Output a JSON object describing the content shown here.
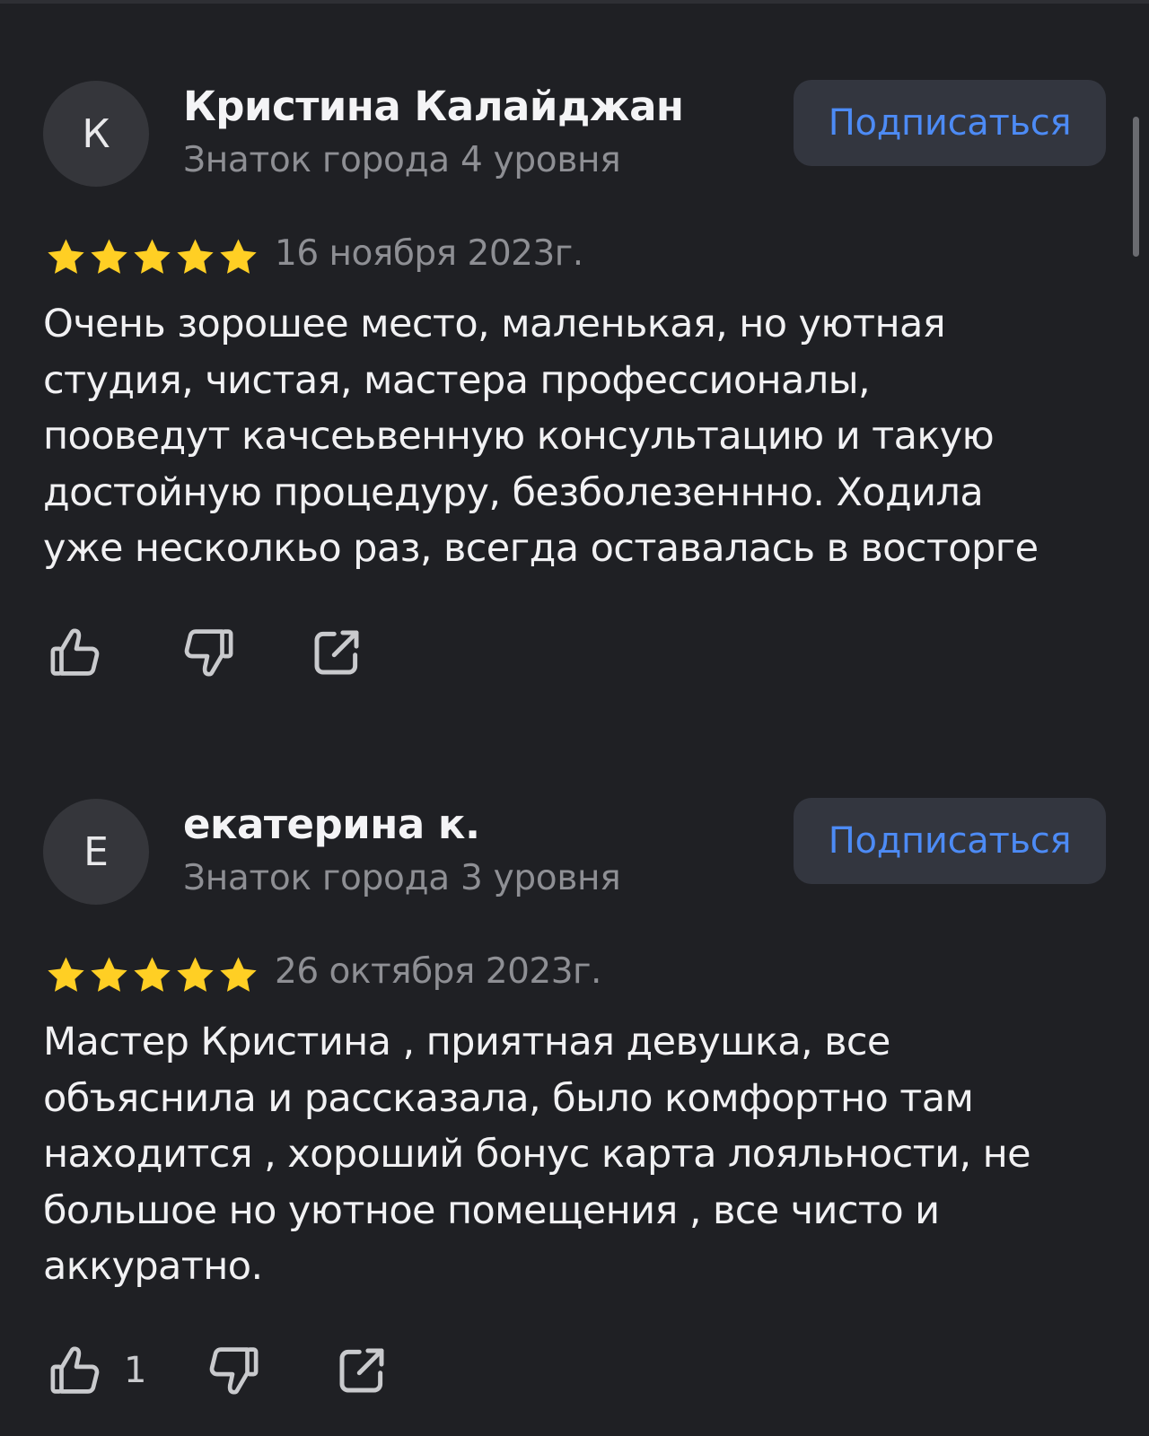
{
  "reviews": [
    {
      "avatar_letter": "К",
      "author_name": "Кристина Калайджан",
      "author_level": "Знаток города 4 уровня",
      "subscribe_label": "Подписаться",
      "rating": 5,
      "date": "16 ноября 2023г.",
      "text_lines": [
        "Очень зорошее место, маленькая, но уютная",
        "студия, чистая, мастера профессионалы,",
        "пооведут качсеьвенную консультацию и такую",
        "достойную процедуру, безболезеннно. Ходила",
        "уже несколкьо раз, всегда оставалась в восторге"
      ],
      "like_count": "",
      "icons": {
        "like": "thumbs-up-icon",
        "dislike": "thumbs-down-icon",
        "share": "share-icon"
      }
    },
    {
      "avatar_letter": "Е",
      "author_name": "екатерина к.",
      "author_level": "Знаток города 3 уровня",
      "subscribe_label": "Подписаться",
      "rating": 5,
      "date": "26 октября 2023г.",
      "text_lines": [
        "Мастер Кристина , приятная девушка, все",
        "объяснила и рассказала, было комфортно там",
        "находится , хороший бонус карта  лояльности, не",
        "большое но уютное помещения , все чисто и",
        "аккуратно."
      ],
      "like_count": "1",
      "icons": {
        "like": "thumbs-up-icon",
        "dislike": "thumbs-down-icon",
        "share": "share-icon"
      }
    }
  ],
  "colors": {
    "background": "#1f2024",
    "button_bg": "#33363f",
    "accent": "#4d8bf5",
    "star": "#ffcf24",
    "muted_text": "#8e8f94"
  }
}
